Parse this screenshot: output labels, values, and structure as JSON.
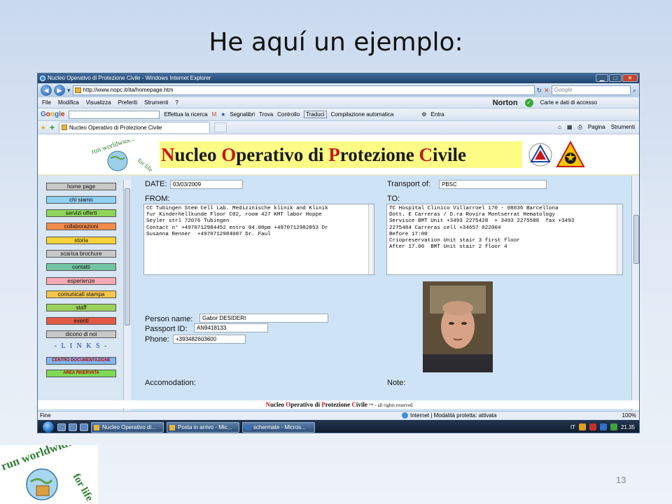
{
  "slide": {
    "title": "He aquí un ejemplo:",
    "number": "13"
  },
  "window": {
    "title": "Nucleo Operativo di Protezione Civile - Windows Internet Explorer",
    "controls": {
      "minimize": "▁",
      "maximize": "□",
      "close": "✕"
    }
  },
  "address": {
    "url": "http://www.nopc.it/ita/homepage.htm",
    "search_placeholder": "Google"
  },
  "menu": {
    "items": [
      "File",
      "Modifica",
      "Visualizza",
      "Preferiti",
      "Strumenti",
      "?"
    ],
    "norton": "Norton",
    "norton_cards": "Carte e dati di accesso"
  },
  "google_toolbar": {
    "search_label": "Effettua la ricerca",
    "bookmarks": "Segnalibri",
    "find": "Trova",
    "check": "Controllo",
    "translate": "Traduci",
    "autofill": "Compilazione automatica",
    "signin": "Entra"
  },
  "tabs": {
    "active": "Nucleo Operativo di Protezione Civile",
    "page_menu": "Pagina",
    "tools_menu": "Strumenti"
  },
  "banner": {
    "parts": [
      {
        "cap": "N",
        "rest": "ucleo "
      },
      {
        "cap": "O",
        "rest": "perativo di "
      },
      {
        "cap": "P",
        "rest": "rotezione "
      },
      {
        "cap": "C",
        "rest": "ivile"
      }
    ],
    "logo_text": "run worldwide... for life"
  },
  "sidebar": {
    "items": [
      {
        "label": "home page",
        "color": "#c8c8c8"
      },
      {
        "label": "chi siamo",
        "color": "#8fd0f3"
      },
      {
        "label": "servizi offerti",
        "color": "#8ed65a"
      },
      {
        "label": "collaborazioni",
        "color": "#f28a4a"
      },
      {
        "label": "storia",
        "color": "#f6d23a"
      },
      {
        "label": "scarica brochure",
        "color": "#c8c8c8"
      },
      {
        "label": "contatti",
        "color": "#74c6a2"
      },
      {
        "label": "esperienze",
        "color": "#f5a9b4"
      },
      {
        "label": "comunicati stampa",
        "color": "#f5c64a"
      },
      {
        "label": "staff",
        "color": "#9bd15a"
      },
      {
        "label": "eventi",
        "color": "#e05a46"
      },
      {
        "label": "dicono di noi",
        "color": "#c8c8c8"
      }
    ],
    "links_heading": "- L I N K S -",
    "special": [
      {
        "label": "CENTRO DOCUMENTAZIONE",
        "color": "#7fb7ee",
        "text": "#c00000"
      },
      {
        "label": "AREA RISERVATA",
        "color": "#7ed957",
        "text": "#c00000"
      }
    ]
  },
  "form": {
    "date_label": "DATE:",
    "date_value": "03/03/2009",
    "transport_label": "Transport of:",
    "transport_value": "PBSC",
    "from_label": "FROM:",
    "from_value": "CC Tubingen Stem Cell Lab. Medizinische klinik and Klinik\nfur Kinderhellkunde Floor C02, room 427 KMT labor Hoppe\nSeyler strl 72076 Tubingen\nContact n° +4970712984452 entro 04.00pm +4970712982853 Dr\nSusanna Renner  +4970712984087 Dr. Faul",
    "to_label": "TO:",
    "to_value": "TC Hospital Clinico Villarroel 170 - 08036 Barcellona\nDott. E Carreras / D.ra Rovira Montserrat Hematology\nServisce BMT Unit +3493 2275428  + 3493 2275588  fax +3493\n2275484 Carreras cell +34657 022004\nBefore 17:00\nCriopreservation Unit stair 3 first floor\nAfter 17.00  BMT Unit stair 2 floor 4",
    "person_label": "Person name:",
    "person_value": "Gabor DESIDERI",
    "passport_label": "Passport ID:",
    "passport_value": "AN9418133",
    "phone_label": "Phone:",
    "phone_value": "+393482603600",
    "accommodation_label": "Accomodation:",
    "note_label": "Note:"
  },
  "footer": {
    "parts": [
      {
        "cap": "N",
        "rest": "ucleo "
      },
      {
        "cap": "O",
        "rest": "perativo di "
      },
      {
        "cap": "P",
        "rest": "rotezione "
      },
      {
        "cap": "C",
        "rest": "ivile"
      }
    ],
    "suffix": " ™ - all rights reserved"
  },
  "status": {
    "left": "Fine",
    "zone": "Internet | Modalità protetta: attivata",
    "zoom": "100%"
  },
  "taskbar": {
    "buttons": [
      "Nucleo Operativo di...",
      "Posta in arrivo - Mic...",
      "schermate - Micros..."
    ],
    "lang": "IT",
    "clock": "21.35"
  }
}
